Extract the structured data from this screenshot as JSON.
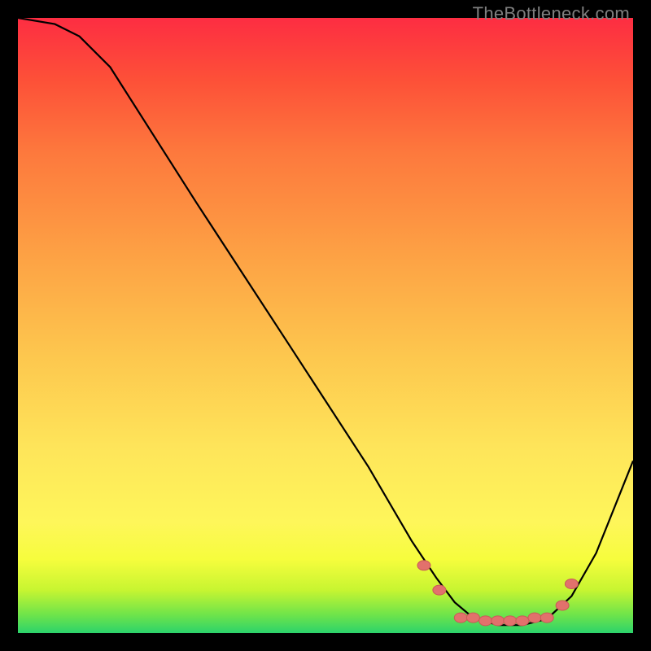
{
  "watermark": "TheBottleneck.com",
  "colors": {
    "curve": "#000000",
    "dot_fill": "#e2716c",
    "dot_stroke": "#c95a56"
  },
  "chart_data": {
    "type": "line",
    "title": "",
    "xlabel": "",
    "ylabel": "",
    "xlim": [
      0,
      100
    ],
    "ylim": [
      0,
      100
    ],
    "curve": [
      {
        "x": 0,
        "y": 100
      },
      {
        "x": 6,
        "y": 99
      },
      {
        "x": 10,
        "y": 97
      },
      {
        "x": 15,
        "y": 92
      },
      {
        "x": 29,
        "y": 70
      },
      {
        "x": 44,
        "y": 47
      },
      {
        "x": 57,
        "y": 27
      },
      {
        "x": 64,
        "y": 15
      },
      {
        "x": 68,
        "y": 9
      },
      {
        "x": 71,
        "y": 5
      },
      {
        "x": 74,
        "y": 2.5
      },
      {
        "x": 78,
        "y": 1.3
      },
      {
        "x": 82,
        "y": 1.3
      },
      {
        "x": 86,
        "y": 2.3
      },
      {
        "x": 90,
        "y": 6
      },
      {
        "x": 94,
        "y": 13
      },
      {
        "x": 100,
        "y": 28
      }
    ],
    "points": [
      {
        "x": 66,
        "y": 11
      },
      {
        "x": 68.5,
        "y": 7
      },
      {
        "x": 72,
        "y": 2.5
      },
      {
        "x": 74,
        "y": 2.5
      },
      {
        "x": 76,
        "y": 2
      },
      {
        "x": 78,
        "y": 2
      },
      {
        "x": 80,
        "y": 2
      },
      {
        "x": 82,
        "y": 2
      },
      {
        "x": 84,
        "y": 2.5
      },
      {
        "x": 86,
        "y": 2.5
      },
      {
        "x": 88.5,
        "y": 4.5
      },
      {
        "x": 90,
        "y": 8
      }
    ]
  }
}
